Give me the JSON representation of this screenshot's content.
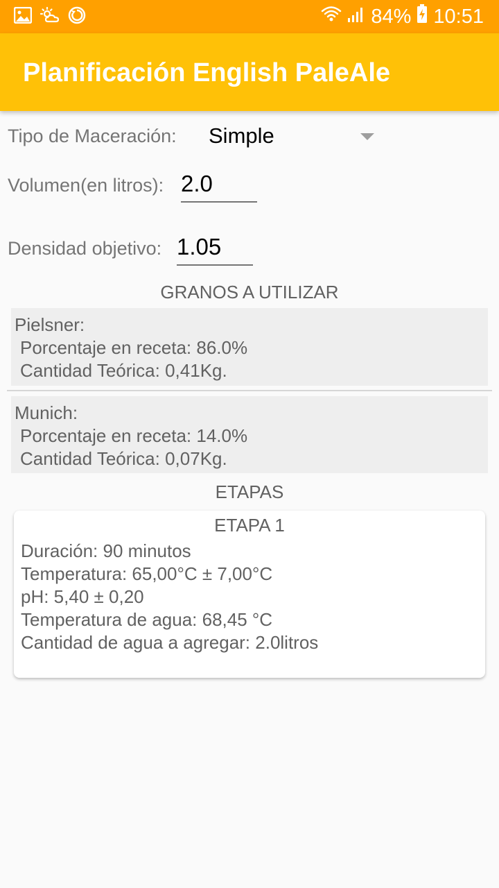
{
  "status_bar": {
    "left_icons": [
      "image-icon",
      "weather-icon",
      "sync-icon"
    ],
    "right_icons": [
      "wifi-icon",
      "signal-icon"
    ],
    "battery": "84%",
    "time": "10:51"
  },
  "app_bar": {
    "title": "Planificación English PaleAle"
  },
  "form": {
    "maceration_label": "Tipo de Maceración:",
    "maceration_value": "Simple",
    "volume_label": "Volumen(en litros):",
    "volume_value": "2.0",
    "density_label": "Densidad objetivo:",
    "density_value": "1.05"
  },
  "grains": {
    "title": "GRANOS A UTILIZAR",
    "items": [
      {
        "name": "Pielsner:",
        "percent": "Porcentaje en receta: 86.0%",
        "amount": "Cantidad Teórica: 0,41Kg."
      },
      {
        "name": "Munich:",
        "percent": "Porcentaje en receta: 14.0%",
        "amount": "Cantidad Teórica: 0,07Kg."
      }
    ]
  },
  "stages": {
    "title": "ETAPAS",
    "items": [
      {
        "title": "ETAPA 1",
        "duration": "Duración: 90 minutos",
        "temperature": "Temperatura: 65,00°C ± 7,00°C",
        "ph": "pH: 5,40 ± 0,20",
        "water_temperature": "Temperatura de agua: 68,45 °C",
        "water_amount": "Cantidad de agua a agregar: 2.0litros"
      }
    ]
  },
  "colors": {
    "status_bar": "#ffa000",
    "app_bar": "#ffc107",
    "background": "#fafafa",
    "grain_background": "#eeeeee"
  }
}
